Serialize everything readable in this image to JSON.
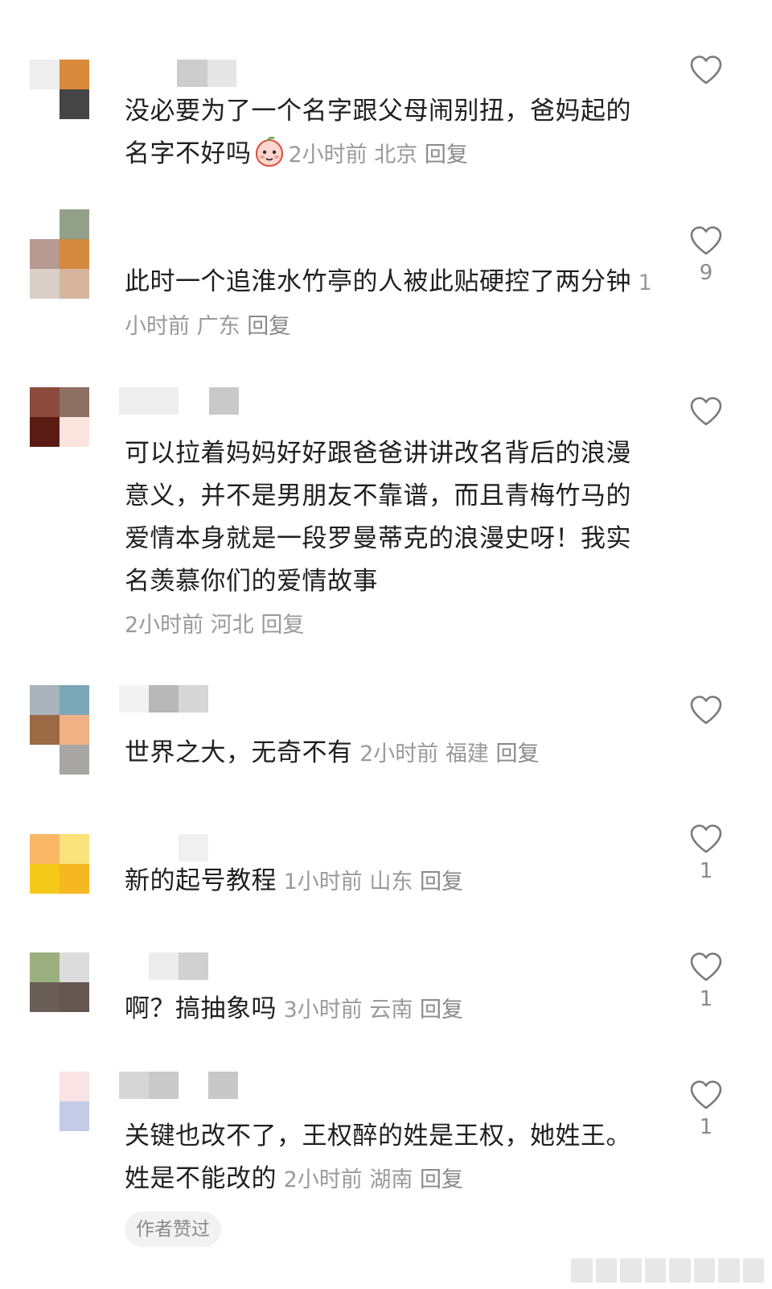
{
  "comments": [
    {
      "text": "没必要为了一个名字跟父母闹别扭，爸妈起的名字不好吗",
      "has_emoji": true,
      "time": "2小时前",
      "location": "北京",
      "reply": "回复",
      "likes": ""
    },
    {
      "text": "此时一个追淮水竹亭的人被此贴硬控了两分钟",
      "time": "1小时前",
      "location": "广东",
      "reply": "回复",
      "likes": "9"
    },
    {
      "text": "可以拉着妈妈好好跟爸爸讲讲改名背后的浪漫意义，并不是男朋友不靠谱，而且青梅竹马的爱情本身就是一段罗曼蒂克的浪漫史呀！我实名羡慕你们的爱情故事",
      "time": "2小时前",
      "location": "河北",
      "reply": "回复",
      "likes": ""
    },
    {
      "text": "世界之大，无奇不有",
      "time": "2小时前",
      "location": "福建",
      "reply": "回复",
      "likes": ""
    },
    {
      "text": "新的起号教程",
      "time": "1小时前",
      "location": "山东",
      "reply": "回复",
      "likes": "1"
    },
    {
      "text": "啊？搞抽象吗",
      "time": "3小时前",
      "location": "云南",
      "reply": "回复",
      "likes": "1"
    },
    {
      "text": "关键也改不了，王权醉的姓是王权，她姓王。姓是不能改的",
      "time": "2小时前",
      "location": "湖南",
      "reply": "回复",
      "likes": "1",
      "badge": "作者赞过"
    }
  ],
  "icons": {
    "like": "heart-outline-icon",
    "emoji": "peach-face-emoji-icon"
  },
  "colors": {
    "text": "#1f1f1f",
    "meta": "#9a9a9a",
    "icon": "#7a7a7a",
    "badge_bg": "#f2f2f2"
  }
}
